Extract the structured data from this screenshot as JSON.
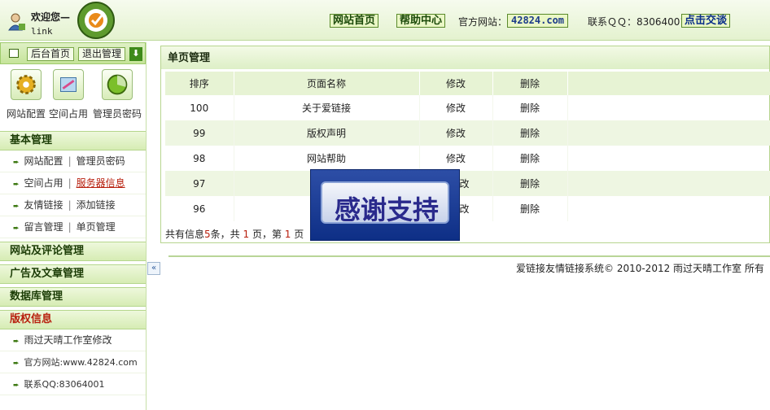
{
  "header": {
    "welcome": "欢迎您—",
    "username": "link",
    "nav_home": "网站首页",
    "nav_help": "帮助中心",
    "site_label": "官方网站：",
    "site_value": "42824.com",
    "qq_label": "联系ＱＱ：83064001",
    "qq_button": "点击交谈"
  },
  "sidebar": {
    "top_home": "后台首页",
    "top_logout": "退出管理",
    "tools": [
      {
        "label": "网站配置",
        "icon": "gear-icon"
      },
      {
        "label": "空间占用",
        "icon": "pie-chart-icon"
      },
      {
        "label": "管理员密码",
        "icon": "shield-icon"
      }
    ],
    "sections": {
      "basic": "基本管理",
      "site_comment": "网站及评论管理",
      "ad_article": "广告及文章管理",
      "database": "数据库管理",
      "copyright": "版权信息"
    },
    "basic_items": [
      {
        "a": "网站配置",
        "b": "管理员密码"
      },
      {
        "a": "空间占用",
        "b": "服务器信息"
      },
      {
        "a": "友情链接",
        "b": "添加链接"
      },
      {
        "a": "留言管理",
        "b": "单页管理"
      }
    ],
    "copyright_items": [
      "雨过天晴工作室修改",
      "官方网站:www.42824.com",
      "联系QQ:83064001"
    ]
  },
  "main": {
    "title": "单页管理",
    "columns": [
      "排序",
      "页面名称",
      "修改",
      "删除"
    ],
    "rows": [
      {
        "order": "100",
        "name": "关于爱链接",
        "edit": "修改",
        "del": "删除"
      },
      {
        "order": "99",
        "name": "版权声明",
        "edit": "修改",
        "del": "删除"
      },
      {
        "order": "98",
        "name": "网站帮助",
        "edit": "修改",
        "del": "删除"
      },
      {
        "order": "97",
        "name": "",
        "edit": "改",
        "del": "删除"
      },
      {
        "order": "96",
        "name": "",
        "edit": "改",
        "del": "删除"
      }
    ],
    "info_prefix": "共有信息",
    "info_count": "5",
    "info_mid": "条，共 ",
    "info_pages": "1",
    "info_mid2": " 页，第 ",
    "info_page": "1",
    "info_suffix": " 页",
    "copyright": "爱链接友情链接系统© 2010-2012 雨过天晴工作室 所有",
    "thanks": "感谢支持"
  }
}
